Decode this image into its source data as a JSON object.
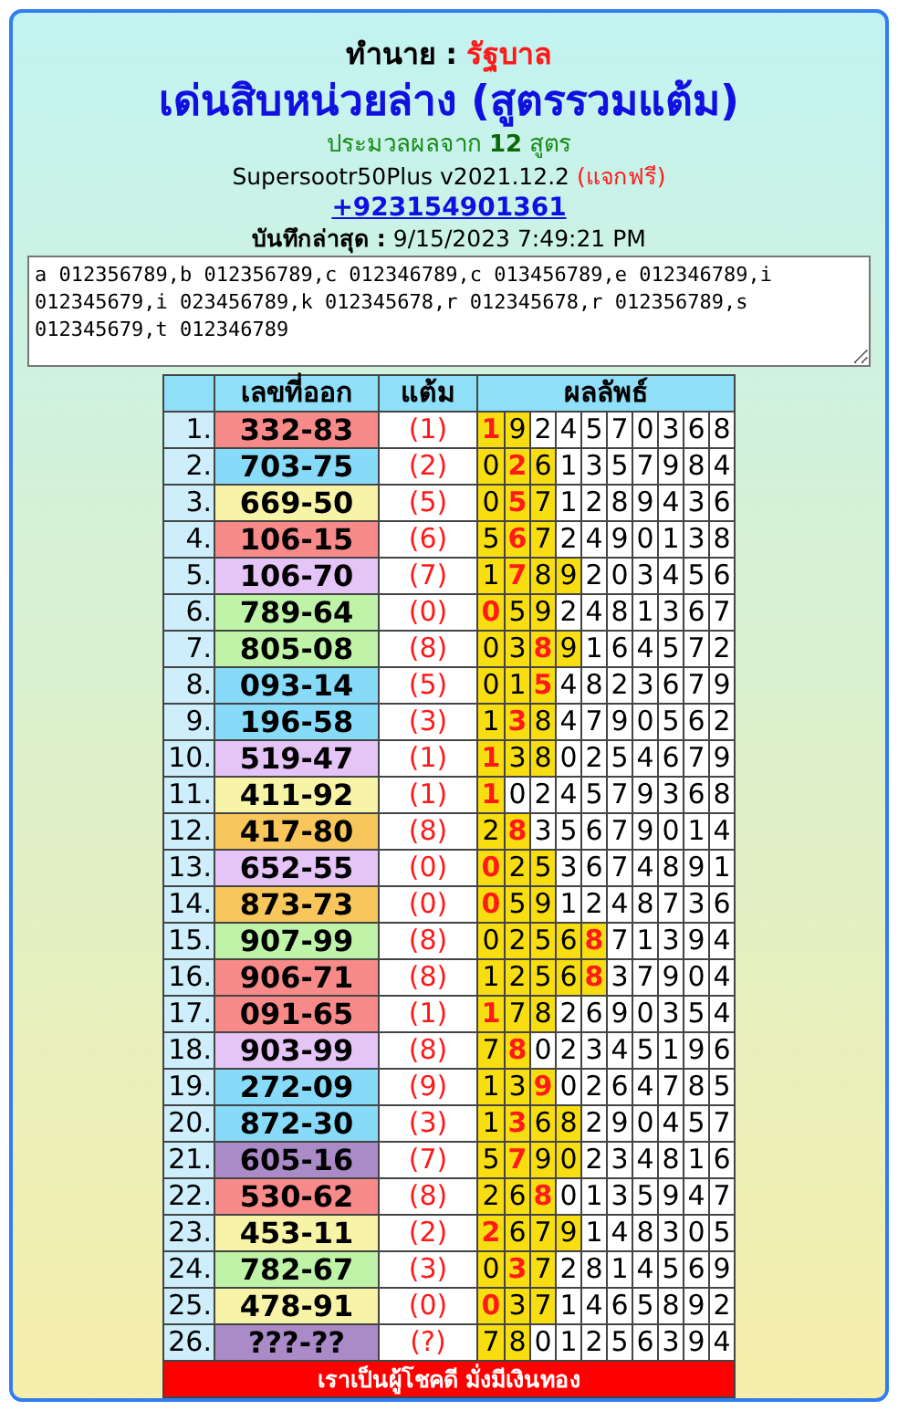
{
  "header": {
    "label": "ทำนาย :",
    "value": "รัฐบาล",
    "title": "เด่นสิบหน่วยล่าง (สูตรรวมแต้ม)",
    "summary": "ประมวลผลจาก **12** สูตร",
    "version": "Supersootr50Plus v2021.12.2",
    "version_note": "(แจกฟรี)",
    "phone": "+923154901361",
    "saved": "**บันทึกล่าสุด :** 9/15/2023 7:49:21 PM"
  },
  "formulas": "a 012356789,b 012356789,c 012346789,c 013456789,e 012346789,i 012345679,i 023456789,k 012345678,r 012345678,r 012356789,s 012345679,t 012346789",
  "table": {
    "columns": [
      "เลขที่ออก",
      "แต้ม",
      "ผลลัพธ์"
    ],
    "rows": [
      {
        "index": "1.",
        "code": "332-83",
        "color": "#f88a8a",
        "score": "(1)",
        "cells": [
          {
            "digit": "1",
            "marked": true,
            "bold": true
          },
          {
            "digit": "9",
            "marked": true,
            "bold": false
          },
          {
            "digit": "2",
            "marked": false,
            "bold": false
          },
          {
            "digit": "4",
            "marked": false,
            "bold": false
          },
          {
            "digit": "5",
            "marked": false,
            "bold": false
          },
          {
            "digit": "7",
            "marked": false,
            "bold": false
          },
          {
            "digit": "0",
            "marked": false,
            "bold": false
          },
          {
            "digit": "3",
            "marked": false,
            "bold": false
          },
          {
            "digit": "6",
            "marked": false,
            "bold": false
          },
          {
            "digit": "8",
            "marked": false,
            "bold": false
          }
        ]
      },
      {
        "index": "2.",
        "code": "703-75",
        "color": "#87dbf8",
        "score": "(2)",
        "cells": [
          {
            "digit": "0",
            "marked": true,
            "bold": false
          },
          {
            "digit": "2",
            "marked": true,
            "bold": true
          },
          {
            "digit": "6",
            "marked": true,
            "bold": false
          },
          {
            "digit": "1",
            "marked": false,
            "bold": false
          },
          {
            "digit": "3",
            "marked": false,
            "bold": false
          },
          {
            "digit": "5",
            "marked": false,
            "bold": false
          },
          {
            "digit": "7",
            "marked": false,
            "bold": false
          },
          {
            "digit": "9",
            "marked": false,
            "bold": false
          },
          {
            "digit": "8",
            "marked": false,
            "bold": false
          },
          {
            "digit": "4",
            "marked": false,
            "bold": false
          }
        ]
      },
      {
        "index": "3.",
        "code": "669-50",
        "color": "#f7f4a8",
        "score": "(5)",
        "cells": [
          {
            "digit": "0",
            "marked": true,
            "bold": false
          },
          {
            "digit": "5",
            "marked": true,
            "bold": true
          },
          {
            "digit": "7",
            "marked": true,
            "bold": false
          },
          {
            "digit": "1",
            "marked": false,
            "bold": false
          },
          {
            "digit": "2",
            "marked": false,
            "bold": false
          },
          {
            "digit": "8",
            "marked": false,
            "bold": false
          },
          {
            "digit": "9",
            "marked": false,
            "bold": false
          },
          {
            "digit": "4",
            "marked": false,
            "bold": false
          },
          {
            "digit": "3",
            "marked": false,
            "bold": false
          },
          {
            "digit": "6",
            "marked": false,
            "bold": false
          }
        ]
      },
      {
        "index": "4.",
        "code": "106-15",
        "color": "#f88a8a",
        "score": "(6)",
        "cells": [
          {
            "digit": "5",
            "marked": true,
            "bold": false
          },
          {
            "digit": "6",
            "marked": true,
            "bold": true
          },
          {
            "digit": "7",
            "marked": true,
            "bold": false
          },
          {
            "digit": "2",
            "marked": false,
            "bold": false
          },
          {
            "digit": "4",
            "marked": false,
            "bold": false
          },
          {
            "digit": "9",
            "marked": false,
            "bold": false
          },
          {
            "digit": "0",
            "marked": false,
            "bold": false
          },
          {
            "digit": "1",
            "marked": false,
            "bold": false
          },
          {
            "digit": "3",
            "marked": false,
            "bold": false
          },
          {
            "digit": "8",
            "marked": false,
            "bold": false
          }
        ]
      },
      {
        "index": "5.",
        "code": "106-70",
        "color": "#e5c4f8",
        "score": "(7)",
        "cells": [
          {
            "digit": "1",
            "marked": true,
            "bold": false
          },
          {
            "digit": "7",
            "marked": true,
            "bold": true
          },
          {
            "digit": "8",
            "marked": true,
            "bold": false
          },
          {
            "digit": "9",
            "marked": true,
            "bold": false
          },
          {
            "digit": "2",
            "marked": false,
            "bold": false
          },
          {
            "digit": "0",
            "marked": false,
            "bold": false
          },
          {
            "digit": "3",
            "marked": false,
            "bold": false
          },
          {
            "digit": "4",
            "marked": false,
            "bold": false
          },
          {
            "digit": "5",
            "marked": false,
            "bold": false
          },
          {
            "digit": "6",
            "marked": false,
            "bold": false
          }
        ]
      },
      {
        "index": "6.",
        "code": "789-64",
        "color": "#bff4a8",
        "score": "(0)",
        "cells": [
          {
            "digit": "0",
            "marked": true,
            "bold": true
          },
          {
            "digit": "5",
            "marked": true,
            "bold": false
          },
          {
            "digit": "9",
            "marked": true,
            "bold": false
          },
          {
            "digit": "2",
            "marked": false,
            "bold": false
          },
          {
            "digit": "4",
            "marked": false,
            "bold": false
          },
          {
            "digit": "8",
            "marked": false,
            "bold": false
          },
          {
            "digit": "1",
            "marked": false,
            "bold": false
          },
          {
            "digit": "3",
            "marked": false,
            "bold": false
          },
          {
            "digit": "6",
            "marked": false,
            "bold": false
          },
          {
            "digit": "7",
            "marked": false,
            "bold": false
          }
        ]
      },
      {
        "index": "7.",
        "code": "805-08",
        "color": "#bff4a8",
        "score": "(8)",
        "cells": [
          {
            "digit": "0",
            "marked": true,
            "bold": false
          },
          {
            "digit": "3",
            "marked": true,
            "bold": false
          },
          {
            "digit": "8",
            "marked": true,
            "bold": true
          },
          {
            "digit": "9",
            "marked": true,
            "bold": false
          },
          {
            "digit": "1",
            "marked": false,
            "bold": false
          },
          {
            "digit": "6",
            "marked": false,
            "bold": false
          },
          {
            "digit": "4",
            "marked": false,
            "bold": false
          },
          {
            "digit": "5",
            "marked": false,
            "bold": false
          },
          {
            "digit": "7",
            "marked": false,
            "bold": false
          },
          {
            "digit": "2",
            "marked": false,
            "bold": false
          }
        ]
      },
      {
        "index": "8.",
        "code": "093-14",
        "color": "#87dbf8",
        "score": "(5)",
        "cells": [
          {
            "digit": "0",
            "marked": true,
            "bold": false
          },
          {
            "digit": "1",
            "marked": true,
            "bold": false
          },
          {
            "digit": "5",
            "marked": true,
            "bold": true
          },
          {
            "digit": "4",
            "marked": false,
            "bold": false
          },
          {
            "digit": "8",
            "marked": false,
            "bold": false
          },
          {
            "digit": "2",
            "marked": false,
            "bold": false
          },
          {
            "digit": "3",
            "marked": false,
            "bold": false
          },
          {
            "digit": "6",
            "marked": false,
            "bold": false
          },
          {
            "digit": "7",
            "marked": false,
            "bold": false
          },
          {
            "digit": "9",
            "marked": false,
            "bold": false
          }
        ]
      },
      {
        "index": "9.",
        "code": "196-58",
        "color": "#87dbf8",
        "score": "(3)",
        "cells": [
          {
            "digit": "1",
            "marked": true,
            "bold": false
          },
          {
            "digit": "3",
            "marked": true,
            "bold": true
          },
          {
            "digit": "8",
            "marked": true,
            "bold": false
          },
          {
            "digit": "4",
            "marked": false,
            "bold": false
          },
          {
            "digit": "7",
            "marked": false,
            "bold": false
          },
          {
            "digit": "9",
            "marked": false,
            "bold": false
          },
          {
            "digit": "0",
            "marked": false,
            "bold": false
          },
          {
            "digit": "5",
            "marked": false,
            "bold": false
          },
          {
            "digit": "6",
            "marked": false,
            "bold": false
          },
          {
            "digit": "2",
            "marked": false,
            "bold": false
          }
        ]
      },
      {
        "index": "10.",
        "code": "519-47",
        "color": "#e5c4f8",
        "score": "(1)",
        "cells": [
          {
            "digit": "1",
            "marked": true,
            "bold": true
          },
          {
            "digit": "3",
            "marked": true,
            "bold": false
          },
          {
            "digit": "8",
            "marked": true,
            "bold": false
          },
          {
            "digit": "0",
            "marked": false,
            "bold": false
          },
          {
            "digit": "2",
            "marked": false,
            "bold": false
          },
          {
            "digit": "5",
            "marked": false,
            "bold": false
          },
          {
            "digit": "4",
            "marked": false,
            "bold": false
          },
          {
            "digit": "6",
            "marked": false,
            "bold": false
          },
          {
            "digit": "7",
            "marked": false,
            "bold": false
          },
          {
            "digit": "9",
            "marked": false,
            "bold": false
          }
        ]
      },
      {
        "index": "11.",
        "code": "411-92",
        "color": "#f7f4a8",
        "score": "(1)",
        "cells": [
          {
            "digit": "1",
            "marked": true,
            "bold": true
          },
          {
            "digit": "0",
            "marked": false,
            "bold": false
          },
          {
            "digit": "2",
            "marked": false,
            "bold": false
          },
          {
            "digit": "4",
            "marked": false,
            "bold": false
          },
          {
            "digit": "5",
            "marked": false,
            "bold": false
          },
          {
            "digit": "7",
            "marked": false,
            "bold": false
          },
          {
            "digit": "9",
            "marked": false,
            "bold": false
          },
          {
            "digit": "3",
            "marked": false,
            "bold": false
          },
          {
            "digit": "6",
            "marked": false,
            "bold": false
          },
          {
            "digit": "8",
            "marked": false,
            "bold": false
          }
        ]
      },
      {
        "index": "12.",
        "code": "417-80",
        "color": "#f8c65a",
        "score": "(8)",
        "cells": [
          {
            "digit": "2",
            "marked": true,
            "bold": false
          },
          {
            "digit": "8",
            "marked": true,
            "bold": true
          },
          {
            "digit": "3",
            "marked": false,
            "bold": false
          },
          {
            "digit": "5",
            "marked": false,
            "bold": false
          },
          {
            "digit": "6",
            "marked": false,
            "bold": false
          },
          {
            "digit": "7",
            "marked": false,
            "bold": false
          },
          {
            "digit": "9",
            "marked": false,
            "bold": false
          },
          {
            "digit": "0",
            "marked": false,
            "bold": false
          },
          {
            "digit": "1",
            "marked": false,
            "bold": false
          },
          {
            "digit": "4",
            "marked": false,
            "bold": false
          }
        ]
      },
      {
        "index": "13.",
        "code": "652-55",
        "color": "#e5c4f8",
        "score": "(0)",
        "cells": [
          {
            "digit": "0",
            "marked": true,
            "bold": true
          },
          {
            "digit": "2",
            "marked": true,
            "bold": false
          },
          {
            "digit": "5",
            "marked": true,
            "bold": false
          },
          {
            "digit": "3",
            "marked": false,
            "bold": false
          },
          {
            "digit": "6",
            "marked": false,
            "bold": false
          },
          {
            "digit": "7",
            "marked": false,
            "bold": false
          },
          {
            "digit": "4",
            "marked": false,
            "bold": false
          },
          {
            "digit": "8",
            "marked": false,
            "bold": false
          },
          {
            "digit": "9",
            "marked": false,
            "bold": false
          },
          {
            "digit": "1",
            "marked": false,
            "bold": false
          }
        ]
      },
      {
        "index": "14.",
        "code": "873-73",
        "color": "#f8c65a",
        "score": "(0)",
        "cells": [
          {
            "digit": "0",
            "marked": true,
            "bold": true
          },
          {
            "digit": "5",
            "marked": true,
            "bold": false
          },
          {
            "digit": "9",
            "marked": true,
            "bold": false
          },
          {
            "digit": "1",
            "marked": false,
            "bold": false
          },
          {
            "digit": "2",
            "marked": false,
            "bold": false
          },
          {
            "digit": "4",
            "marked": false,
            "bold": false
          },
          {
            "digit": "8",
            "marked": false,
            "bold": false
          },
          {
            "digit": "7",
            "marked": false,
            "bold": false
          },
          {
            "digit": "3",
            "marked": false,
            "bold": false
          },
          {
            "digit": "6",
            "marked": false,
            "bold": false
          }
        ]
      },
      {
        "index": "15.",
        "code": "907-99",
        "color": "#bff4a8",
        "score": "(8)",
        "cells": [
          {
            "digit": "0",
            "marked": true,
            "bold": false
          },
          {
            "digit": "2",
            "marked": true,
            "bold": false
          },
          {
            "digit": "5",
            "marked": true,
            "bold": false
          },
          {
            "digit": "6",
            "marked": true,
            "bold": false
          },
          {
            "digit": "8",
            "marked": true,
            "bold": true
          },
          {
            "digit": "7",
            "marked": false,
            "bold": false
          },
          {
            "digit": "1",
            "marked": false,
            "bold": false
          },
          {
            "digit": "3",
            "marked": false,
            "bold": false
          },
          {
            "digit": "9",
            "marked": false,
            "bold": false
          },
          {
            "digit": "4",
            "marked": false,
            "bold": false
          }
        ]
      },
      {
        "index": "16.",
        "code": "906-71",
        "color": "#f88a8a",
        "score": "(8)",
        "cells": [
          {
            "digit": "1",
            "marked": true,
            "bold": false
          },
          {
            "digit": "2",
            "marked": true,
            "bold": false
          },
          {
            "digit": "5",
            "marked": true,
            "bold": false
          },
          {
            "digit": "6",
            "marked": true,
            "bold": false
          },
          {
            "digit": "8",
            "marked": true,
            "bold": true
          },
          {
            "digit": "3",
            "marked": false,
            "bold": false
          },
          {
            "digit": "7",
            "marked": false,
            "bold": false
          },
          {
            "digit": "9",
            "marked": false,
            "bold": false
          },
          {
            "digit": "0",
            "marked": false,
            "bold": false
          },
          {
            "digit": "4",
            "marked": false,
            "bold": false
          }
        ]
      },
      {
        "index": "17.",
        "code": "091-65",
        "color": "#f88a8a",
        "score": "(1)",
        "cells": [
          {
            "digit": "1",
            "marked": true,
            "bold": true
          },
          {
            "digit": "7",
            "marked": true,
            "bold": false
          },
          {
            "digit": "8",
            "marked": true,
            "bold": false
          },
          {
            "digit": "2",
            "marked": false,
            "bold": false
          },
          {
            "digit": "6",
            "marked": false,
            "bold": false
          },
          {
            "digit": "9",
            "marked": false,
            "bold": false
          },
          {
            "digit": "0",
            "marked": false,
            "bold": false
          },
          {
            "digit": "3",
            "marked": false,
            "bold": false
          },
          {
            "digit": "5",
            "marked": false,
            "bold": false
          },
          {
            "digit": "4",
            "marked": false,
            "bold": false
          }
        ]
      },
      {
        "index": "18.",
        "code": "903-99",
        "color": "#e5c4f8",
        "score": "(8)",
        "cells": [
          {
            "digit": "7",
            "marked": true,
            "bold": false
          },
          {
            "digit": "8",
            "marked": true,
            "bold": true
          },
          {
            "digit": "0",
            "marked": false,
            "bold": false
          },
          {
            "digit": "2",
            "marked": false,
            "bold": false
          },
          {
            "digit": "3",
            "marked": false,
            "bold": false
          },
          {
            "digit": "4",
            "marked": false,
            "bold": false
          },
          {
            "digit": "5",
            "marked": false,
            "bold": false
          },
          {
            "digit": "1",
            "marked": false,
            "bold": false
          },
          {
            "digit": "9",
            "marked": false,
            "bold": false
          },
          {
            "digit": "6",
            "marked": false,
            "bold": false
          }
        ]
      },
      {
        "index": "19.",
        "code": "272-09",
        "color": "#87dbf8",
        "score": "(9)",
        "cells": [
          {
            "digit": "1",
            "marked": true,
            "bold": false
          },
          {
            "digit": "3",
            "marked": true,
            "bold": false
          },
          {
            "digit": "9",
            "marked": true,
            "bold": true
          },
          {
            "digit": "0",
            "marked": false,
            "bold": false
          },
          {
            "digit": "2",
            "marked": false,
            "bold": false
          },
          {
            "digit": "6",
            "marked": false,
            "bold": false
          },
          {
            "digit": "4",
            "marked": false,
            "bold": false
          },
          {
            "digit": "7",
            "marked": false,
            "bold": false
          },
          {
            "digit": "8",
            "marked": false,
            "bold": false
          },
          {
            "digit": "5",
            "marked": false,
            "bold": false
          }
        ]
      },
      {
        "index": "20.",
        "code": "872-30",
        "color": "#87dbf8",
        "score": "(3)",
        "cells": [
          {
            "digit": "1",
            "marked": true,
            "bold": false
          },
          {
            "digit": "3",
            "marked": true,
            "bold": true
          },
          {
            "digit": "6",
            "marked": true,
            "bold": false
          },
          {
            "digit": "8",
            "marked": true,
            "bold": false
          },
          {
            "digit": "2",
            "marked": false,
            "bold": false
          },
          {
            "digit": "9",
            "marked": false,
            "bold": false
          },
          {
            "digit": "0",
            "marked": false,
            "bold": false
          },
          {
            "digit": "4",
            "marked": false,
            "bold": false
          },
          {
            "digit": "5",
            "marked": false,
            "bold": false
          },
          {
            "digit": "7",
            "marked": false,
            "bold": false
          }
        ]
      },
      {
        "index": "21.",
        "code": "605-16",
        "color": "#aa8bc8",
        "score": "(7)",
        "cells": [
          {
            "digit": "5",
            "marked": true,
            "bold": false
          },
          {
            "digit": "7",
            "marked": true,
            "bold": true
          },
          {
            "digit": "9",
            "marked": true,
            "bold": false
          },
          {
            "digit": "0",
            "marked": true,
            "bold": false
          },
          {
            "digit": "2",
            "marked": false,
            "bold": false
          },
          {
            "digit": "3",
            "marked": false,
            "bold": false
          },
          {
            "digit": "4",
            "marked": false,
            "bold": false
          },
          {
            "digit": "8",
            "marked": false,
            "bold": false
          },
          {
            "digit": "1",
            "marked": false,
            "bold": false
          },
          {
            "digit": "6",
            "marked": false,
            "bold": false
          }
        ]
      },
      {
        "index": "22.",
        "code": "530-62",
        "color": "#f88a8a",
        "score": "(8)",
        "cells": [
          {
            "digit": "2",
            "marked": true,
            "bold": false
          },
          {
            "digit": "6",
            "marked": true,
            "bold": false
          },
          {
            "digit": "8",
            "marked": true,
            "bold": true
          },
          {
            "digit": "0",
            "marked": false,
            "bold": false
          },
          {
            "digit": "1",
            "marked": false,
            "bold": false
          },
          {
            "digit": "3",
            "marked": false,
            "bold": false
          },
          {
            "digit": "5",
            "marked": false,
            "bold": false
          },
          {
            "digit": "9",
            "marked": false,
            "bold": false
          },
          {
            "digit": "4",
            "marked": false,
            "bold": false
          },
          {
            "digit": "7",
            "marked": false,
            "bold": false
          }
        ]
      },
      {
        "index": "23.",
        "code": "453-11",
        "color": "#f7f4a8",
        "score": "(2)",
        "cells": [
          {
            "digit": "2",
            "marked": true,
            "bold": true
          },
          {
            "digit": "6",
            "marked": true,
            "bold": false
          },
          {
            "digit": "7",
            "marked": true,
            "bold": false
          },
          {
            "digit": "9",
            "marked": true,
            "bold": false
          },
          {
            "digit": "1",
            "marked": false,
            "bold": false
          },
          {
            "digit": "4",
            "marked": false,
            "bold": false
          },
          {
            "digit": "8",
            "marked": false,
            "bold": false
          },
          {
            "digit": "3",
            "marked": false,
            "bold": false
          },
          {
            "digit": "0",
            "marked": false,
            "bold": false
          },
          {
            "digit": "5",
            "marked": false,
            "bold": false
          }
        ]
      },
      {
        "index": "24.",
        "code": "782-67",
        "color": "#bff4a8",
        "score": "(3)",
        "cells": [
          {
            "digit": "0",
            "marked": true,
            "bold": false
          },
          {
            "digit": "3",
            "marked": true,
            "bold": true
          },
          {
            "digit": "7",
            "marked": true,
            "bold": false
          },
          {
            "digit": "2",
            "marked": false,
            "bold": false
          },
          {
            "digit": "8",
            "marked": false,
            "bold": false
          },
          {
            "digit": "1",
            "marked": false,
            "bold": false
          },
          {
            "digit": "4",
            "marked": false,
            "bold": false
          },
          {
            "digit": "5",
            "marked": false,
            "bold": false
          },
          {
            "digit": "6",
            "marked": false,
            "bold": false
          },
          {
            "digit": "9",
            "marked": false,
            "bold": false
          }
        ]
      },
      {
        "index": "25.",
        "code": "478-91",
        "color": "#f7f4a8",
        "score": "(0)",
        "cells": [
          {
            "digit": "0",
            "marked": true,
            "bold": true
          },
          {
            "digit": "3",
            "marked": true,
            "bold": false
          },
          {
            "digit": "7",
            "marked": true,
            "bold": false
          },
          {
            "digit": "1",
            "marked": false,
            "bold": false
          },
          {
            "digit": "4",
            "marked": false,
            "bold": false
          },
          {
            "digit": "6",
            "marked": false,
            "bold": false
          },
          {
            "digit": "5",
            "marked": false,
            "bold": false
          },
          {
            "digit": "8",
            "marked": false,
            "bold": false
          },
          {
            "digit": "9",
            "marked": false,
            "bold": false
          },
          {
            "digit": "2",
            "marked": false,
            "bold": false
          }
        ]
      },
      {
        "index": "26.",
        "code": "???-??",
        "color": "#aa8bc8",
        "score": "(?)",
        "cells": [
          {
            "digit": "7",
            "marked": true,
            "bold": false
          },
          {
            "digit": "8",
            "marked": true,
            "bold": false
          },
          {
            "digit": "0",
            "marked": false,
            "bold": false
          },
          {
            "digit": "1",
            "marked": false,
            "bold": false
          },
          {
            "digit": "2",
            "marked": false,
            "bold": false
          },
          {
            "digit": "5",
            "marked": false,
            "bold": false
          },
          {
            "digit": "6",
            "marked": false,
            "bold": false
          },
          {
            "digit": "3",
            "marked": false,
            "bold": false
          },
          {
            "digit": "9",
            "marked": false,
            "bold": false
          },
          {
            "digit": "4",
            "marked": false,
            "bold": false
          }
        ]
      }
    ],
    "footer": "เราเป็นผู้โชคดี มั่งมีเงินทอง"
  }
}
